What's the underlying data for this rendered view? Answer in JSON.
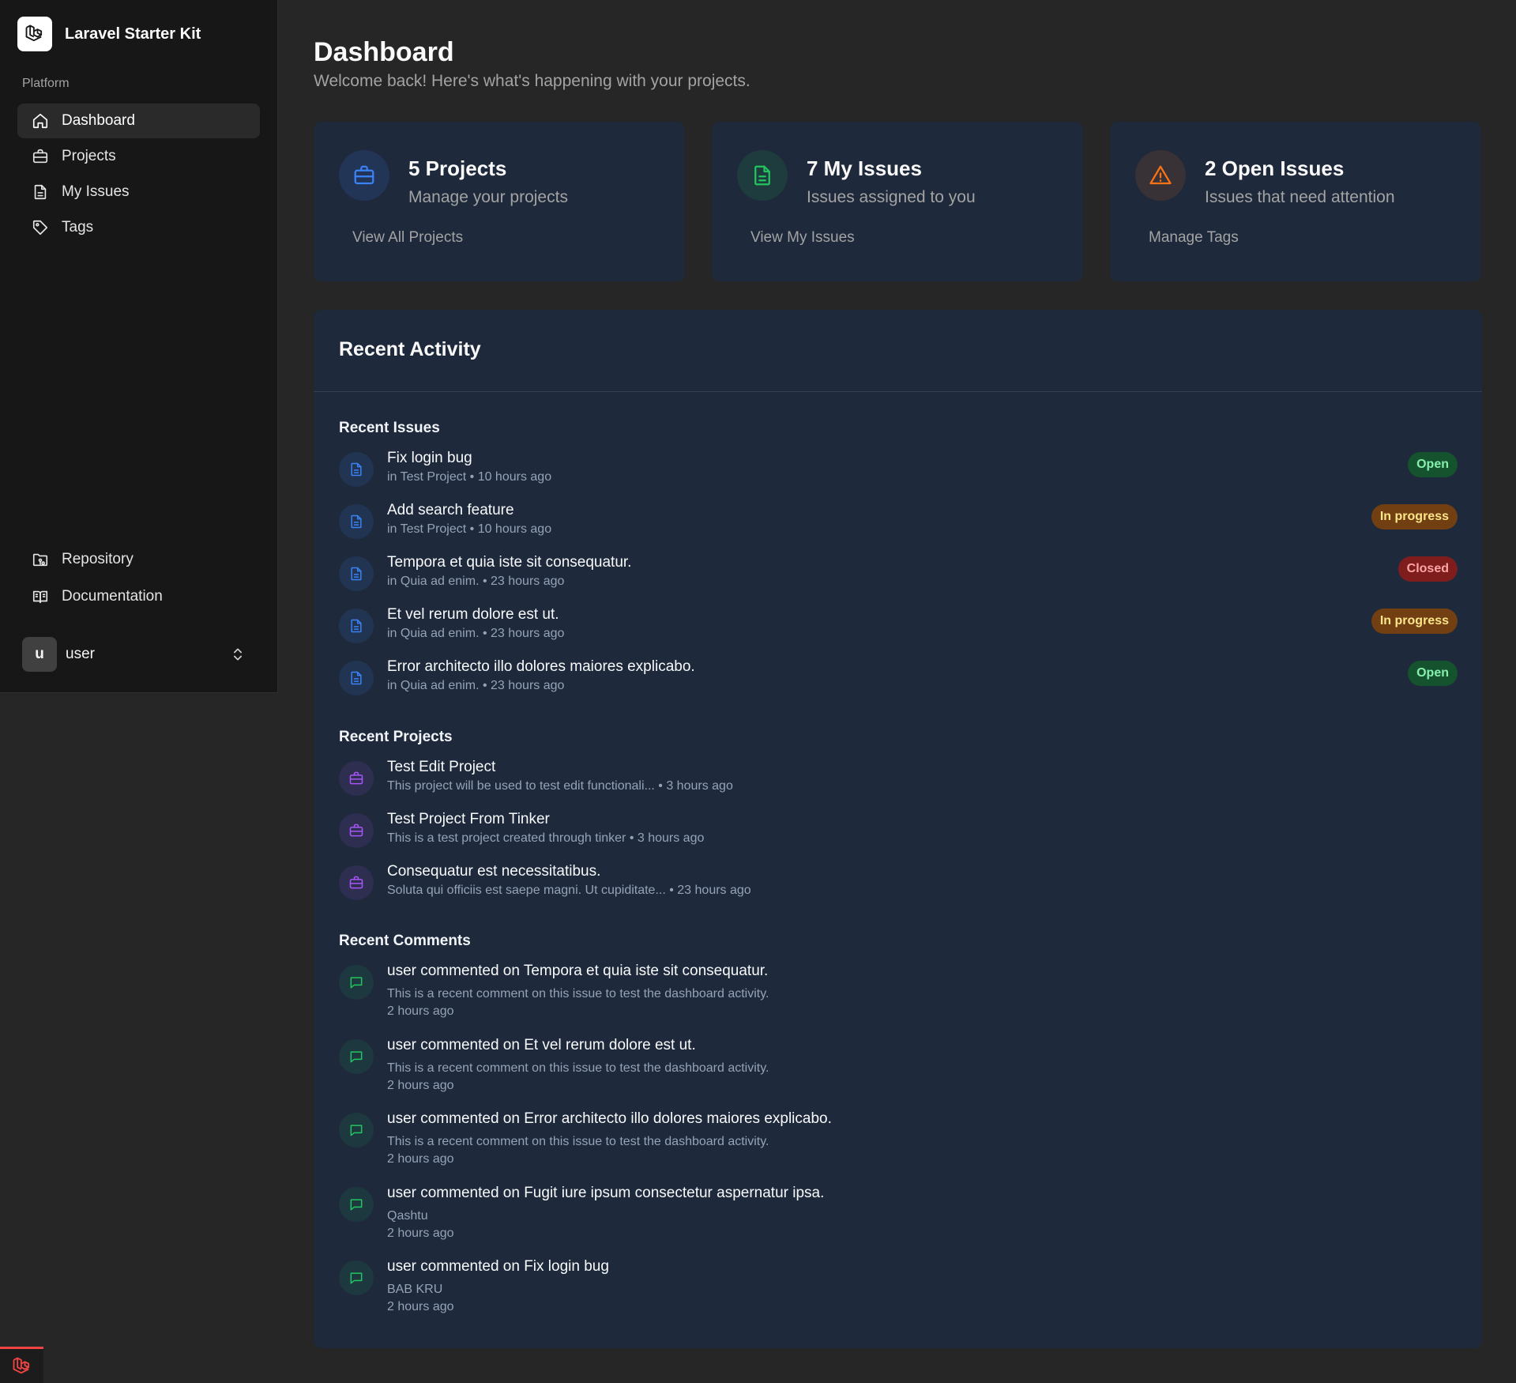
{
  "app": {
    "name": "Laravel Starter Kit"
  },
  "sidebar": {
    "group_label": "Platform",
    "items": [
      {
        "label": "Dashboard",
        "icon": "home-icon",
        "active": true
      },
      {
        "label": "Projects",
        "icon": "briefcase-icon"
      },
      {
        "label": "My Issues",
        "icon": "file-icon"
      },
      {
        "label": "Tags",
        "icon": "tag-icon"
      }
    ],
    "bottom_items": [
      {
        "label": "Repository",
        "icon": "folder-git-icon"
      },
      {
        "label": "Documentation",
        "icon": "book-icon"
      }
    ],
    "user": {
      "initial": "u",
      "name": "user"
    }
  },
  "header": {
    "title": "Dashboard",
    "subtitle": "Welcome back! Here's what's happening with your projects."
  },
  "stats": [
    {
      "title": "5 Projects",
      "description": "Manage your projects",
      "link": "View All Projects",
      "icon": "briefcase-icon",
      "color": "#3b82f6"
    },
    {
      "title": "7 My Issues",
      "description": "Issues assigned to you",
      "link": "View My Issues",
      "icon": "file-icon",
      "color": "#22c55e"
    },
    {
      "title": "2 Open Issues",
      "description": "Issues that need attention",
      "link": "Manage Tags",
      "icon": "alert-triangle-icon",
      "color": "#f97316"
    }
  ],
  "activity": {
    "title": "Recent Activity",
    "issues_label": "Recent Issues",
    "issues": [
      {
        "title": "Fix login bug",
        "meta": "in Test Project • 10 hours ago",
        "status": "Open",
        "status_kind": "open"
      },
      {
        "title": "Add search feature",
        "meta": "in Test Project • 10 hours ago",
        "status": "In progress",
        "status_kind": "progress"
      },
      {
        "title": "Tempora et quia iste sit consequatur.",
        "meta": "in Quia ad enim. • 23 hours ago",
        "status": "Closed",
        "status_kind": "closed"
      },
      {
        "title": "Et vel rerum dolore est ut.",
        "meta": "in Quia ad enim. • 23 hours ago",
        "status": "In progress",
        "status_kind": "progress"
      },
      {
        "title": "Error architecto illo dolores maiores explicabo.",
        "meta": "in Quia ad enim. • 23 hours ago",
        "status": "Open",
        "status_kind": "open"
      }
    ],
    "projects_label": "Recent Projects",
    "projects": [
      {
        "title": "Test Edit Project",
        "meta": "This project will be used to test edit functionali... • 3 hours ago"
      },
      {
        "title": "Test Project From Tinker",
        "meta": "This is a test project created through tinker • 3 hours ago"
      },
      {
        "title": "Consequatur est necessitatibus.",
        "meta": "Soluta qui officiis est saepe magni. Ut cupiditate... • 23 hours ago"
      }
    ],
    "comments_label": "Recent Comments",
    "comments": [
      {
        "who": "user commented on",
        "target": "Tempora et quia iste sit consequatur.",
        "body": "This is a recent comment on this issue to test the dashboard activity.",
        "time": "2 hours ago"
      },
      {
        "who": "user commented on",
        "target": "Et vel rerum dolore est ut.",
        "body": "This is a recent comment on this issue to test the dashboard activity.",
        "time": "2 hours ago"
      },
      {
        "who": "user commented on",
        "target": "Error architecto illo dolores maiores explicabo.",
        "body": "This is a recent comment on this issue to test the dashboard activity.",
        "time": "2 hours ago"
      },
      {
        "who": "user commented on",
        "target": "Fugit iure ipsum consectetur aspernatur ipsa.",
        "body": "Qashtu",
        "time": "2 hours ago"
      },
      {
        "who": "user commented on",
        "target": "Fix login bug",
        "body": "BAB KRU",
        "time": "2 hours ago"
      }
    ]
  },
  "colors": {
    "issue_icon": "#3b82f6",
    "project_icon": "#a855f7",
    "comment_icon": "#22c55e"
  }
}
